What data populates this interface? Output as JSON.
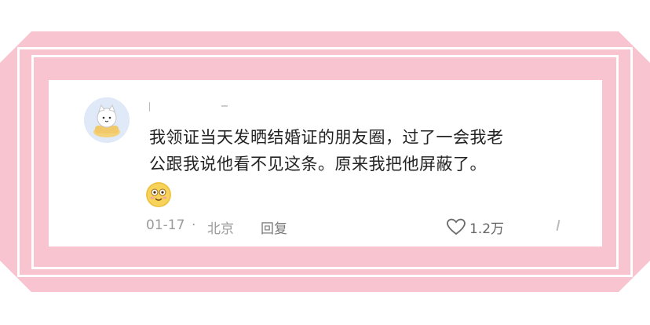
{
  "comment": {
    "text_line1": "我领证当天发晒结婚证的朋友圈，过了一会我老",
    "text_line2": "公跟我说他看不见这条。原来我把他屏蔽了。",
    "date": "01-17",
    "separator": "·",
    "location": "北京",
    "reply_label": "回复",
    "like_count": "1.2万"
  },
  "icons": {
    "avatar": "cartoon-cat-avatar",
    "emoji": "smiling-emoji-icon",
    "like": "heart-outline-icon"
  },
  "colors": {
    "frame_pink": "#f8c4d0",
    "text_primary": "#222222",
    "text_meta": "#9a9a9a",
    "avatar_bg": "#dfe9f7",
    "emoji_yellow": "#f7d35a"
  }
}
